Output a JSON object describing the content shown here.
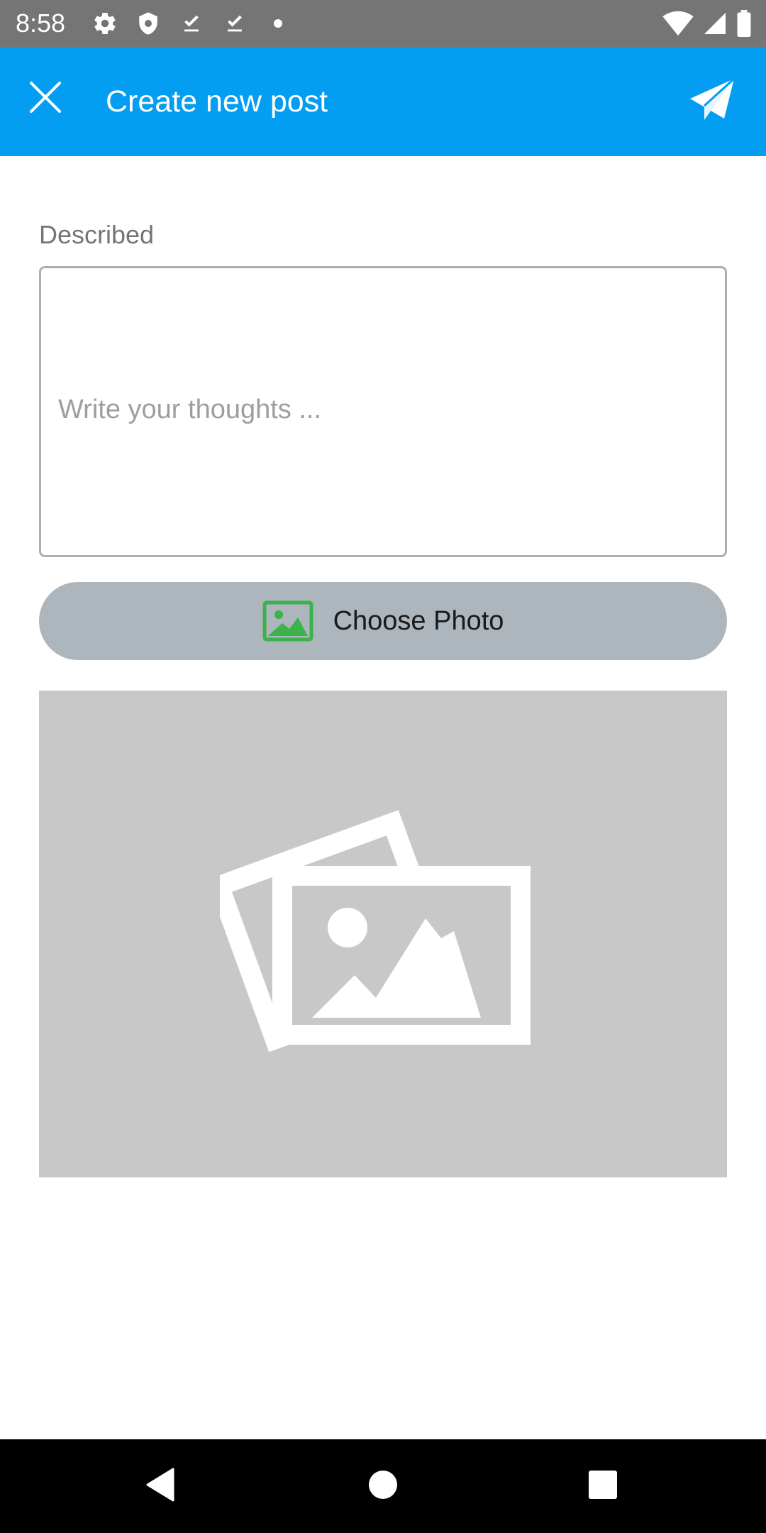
{
  "status_bar": {
    "time": "8:58",
    "left_icons": [
      "gear-icon",
      "shield-icon",
      "download-done-icon",
      "download-done-icon",
      "dot-icon"
    ],
    "right_icons": [
      "wifi-icon",
      "cell-signal-icon",
      "battery-icon"
    ]
  },
  "app_bar": {
    "title": "Create new post",
    "close_icon": "close-icon",
    "send_icon": "send-icon",
    "background_color": "#039df2"
  },
  "form": {
    "description_label": "Described",
    "description_placeholder": "Write your thoughts ...",
    "description_value": "",
    "choose_photo_label": "Choose Photo",
    "choose_photo_icon": "gallery-icon",
    "choose_photo_icon_color": "#3cb34a"
  },
  "preview": {
    "placeholder_icon": "image-placeholder-icon"
  },
  "nav_bar": {
    "buttons": [
      "back-icon",
      "home-icon",
      "recents-icon"
    ]
  }
}
